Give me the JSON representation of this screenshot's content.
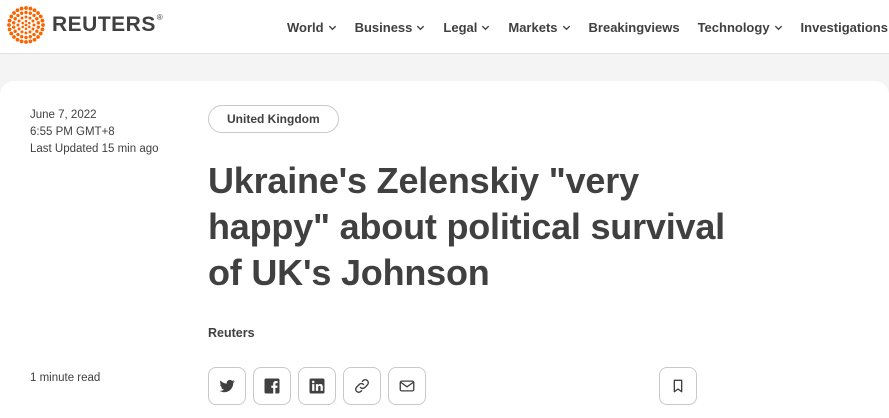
{
  "header": {
    "logo_text": "REUTERS",
    "logo_reg": "®",
    "brand_color": "#fa6400",
    "nav": [
      {
        "label": "World",
        "has_dropdown": true
      },
      {
        "label": "Business",
        "has_dropdown": true
      },
      {
        "label": "Legal",
        "has_dropdown": true
      },
      {
        "label": "Markets",
        "has_dropdown": true
      },
      {
        "label": "Breakingviews",
        "has_dropdown": false
      },
      {
        "label": "Technology",
        "has_dropdown": true
      },
      {
        "label": "Investigations",
        "has_dropdown": false
      }
    ]
  },
  "article": {
    "date": "June 7, 2022",
    "time": "6:55 PM GMT+8",
    "last_updated": "Last Updated 15 min ago",
    "read_time": "1 minute read",
    "tag": "United Kingdom",
    "headline_lines": [
      "Ukraine's Zelenskiy \"very",
      "happy\" about political survival",
      "of UK's Johnson"
    ],
    "byline": "Reuters"
  },
  "share": {
    "icons": [
      "twitter-icon",
      "facebook-icon",
      "linkedin-icon",
      "link-icon",
      "email-icon"
    ],
    "bookmark_icon": "bookmark-icon"
  }
}
